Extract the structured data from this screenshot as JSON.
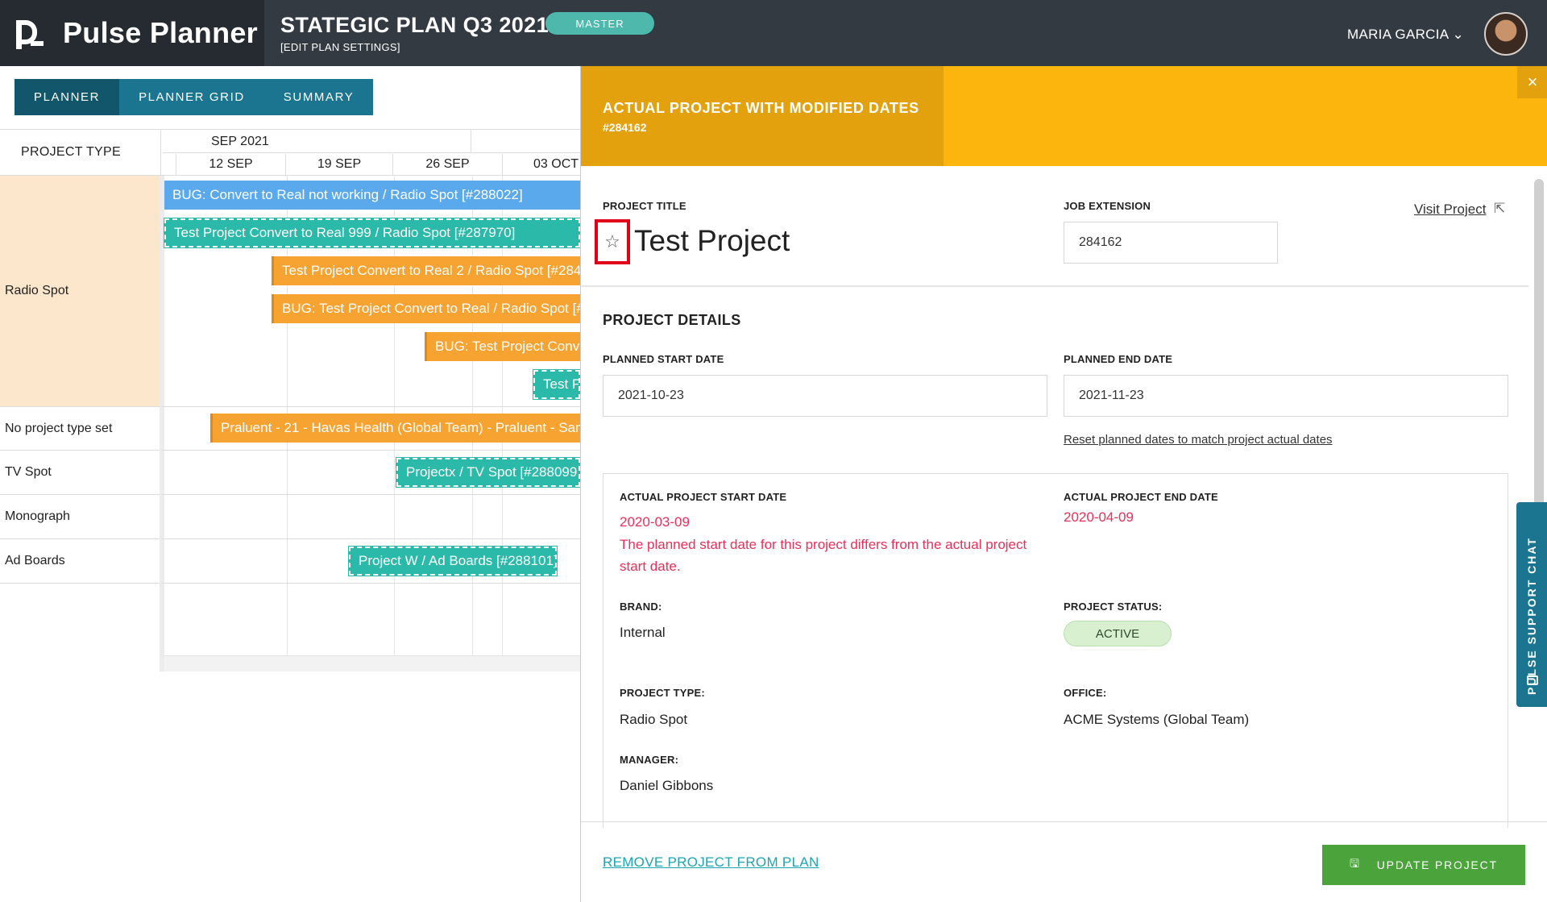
{
  "topbar": {
    "brand_name": "Pulse Planner",
    "plan_title": "STATEGIC PLAN Q3 2021",
    "plan_subtitle": "[EDIT PLAN SETTINGS]",
    "plan_badge": "MASTER",
    "user_name": "MARIA GARCIA ⌄"
  },
  "planner": {
    "tabs": [
      "PLANNER",
      "PLANNER GRID",
      "SUMMARY"
    ],
    "project_type_header": "PROJECT TYPE",
    "month": "SEP 2021",
    "weeks": [
      "12 SEP",
      "19 SEP",
      "26 SEP",
      "03 OCT"
    ],
    "rows": [
      "Radio Spot",
      "No project type set",
      "TV Spot",
      "Monograph",
      "Ad Boards"
    ],
    "bars": [
      {
        "label": "BUG: Convert to Real not working / Radio Spot [#288022]",
        "color": "blue"
      },
      {
        "label": "Test Project Convert to Real 999 / Radio Spot [#287970]",
        "color": "teal"
      },
      {
        "label": "Test Project Convert to Real 2 / Radio Spot [#284",
        "color": "orange"
      },
      {
        "label": "BUG: Test Project Convert to Real / Radio Spot [#",
        "color": "orange"
      },
      {
        "label": "BUG: Test Project Conve",
        "color": "orange"
      },
      {
        "label": "Test Fa",
        "color": "teal"
      },
      {
        "label": "Praluent - 21 - Havas Health (Global Team) - Praluent - Sanc",
        "color": "orange"
      },
      {
        "label": "Projectx / TV Spot [#288099",
        "color": "teal"
      },
      {
        "label": "Project W / Ad Boards [#288101]",
        "color": "teal"
      }
    ]
  },
  "panel": {
    "header_title": "ACTUAL PROJECT WITH MODIFIED DATES",
    "header_id": "#284162",
    "close_icon": "×",
    "project_title_label": "PROJECT TITLE",
    "project_title": "Test Project",
    "star_icon": "☆",
    "job_extension_label": "JOB EXTENSION",
    "job_extension_value": "284162",
    "visit_link": "Visit Project",
    "external_icon": "⇱",
    "details_heading": "PROJECT DETAILS",
    "planned_start_label": "PLANNED START DATE",
    "planned_start_value": "2021-10-23",
    "planned_end_label": "PLANNED END DATE",
    "planned_end_value": "2021-11-23",
    "reset_link": "Reset planned dates to match project actual dates",
    "actual_start_label": "ACTUAL PROJECT START DATE",
    "actual_start_value": "2020-03-09",
    "actual_start_warning": "The planned start date for this project differs from the actual project start date.",
    "actual_end_label": "ACTUAL PROJECT END DATE",
    "actual_end_value": "2020-04-09",
    "brand_label": "BRAND:",
    "brand_value": "Internal",
    "status_label": "PROJECT STATUS:",
    "status_value": "ACTIVE",
    "type_label": "PROJECT TYPE:",
    "type_value": "Radio Spot",
    "office_label": "OFFICE:",
    "office_value": "ACME Systems (Global Team)",
    "manager_label": "MANAGER:",
    "manager_value": "Daniel Gibbons",
    "remove_link": "REMOVE PROJECT FROM PLAN",
    "update_button": "UPDATE PROJECT",
    "update_icon": "🖫",
    "chat_tab": "PULSE SUPPORT CHAT"
  },
  "colors": {
    "header_gold": "#fbb50d",
    "header_gold_dark": "#e3a10d",
    "accent_teal": "#2bb9a9",
    "nav_blue": "#1b7590",
    "bar_blue": "#5aa9ec",
    "bar_orange": "#f6a332",
    "warning_red": "#e8305b",
    "update_green": "#4aa33b"
  }
}
